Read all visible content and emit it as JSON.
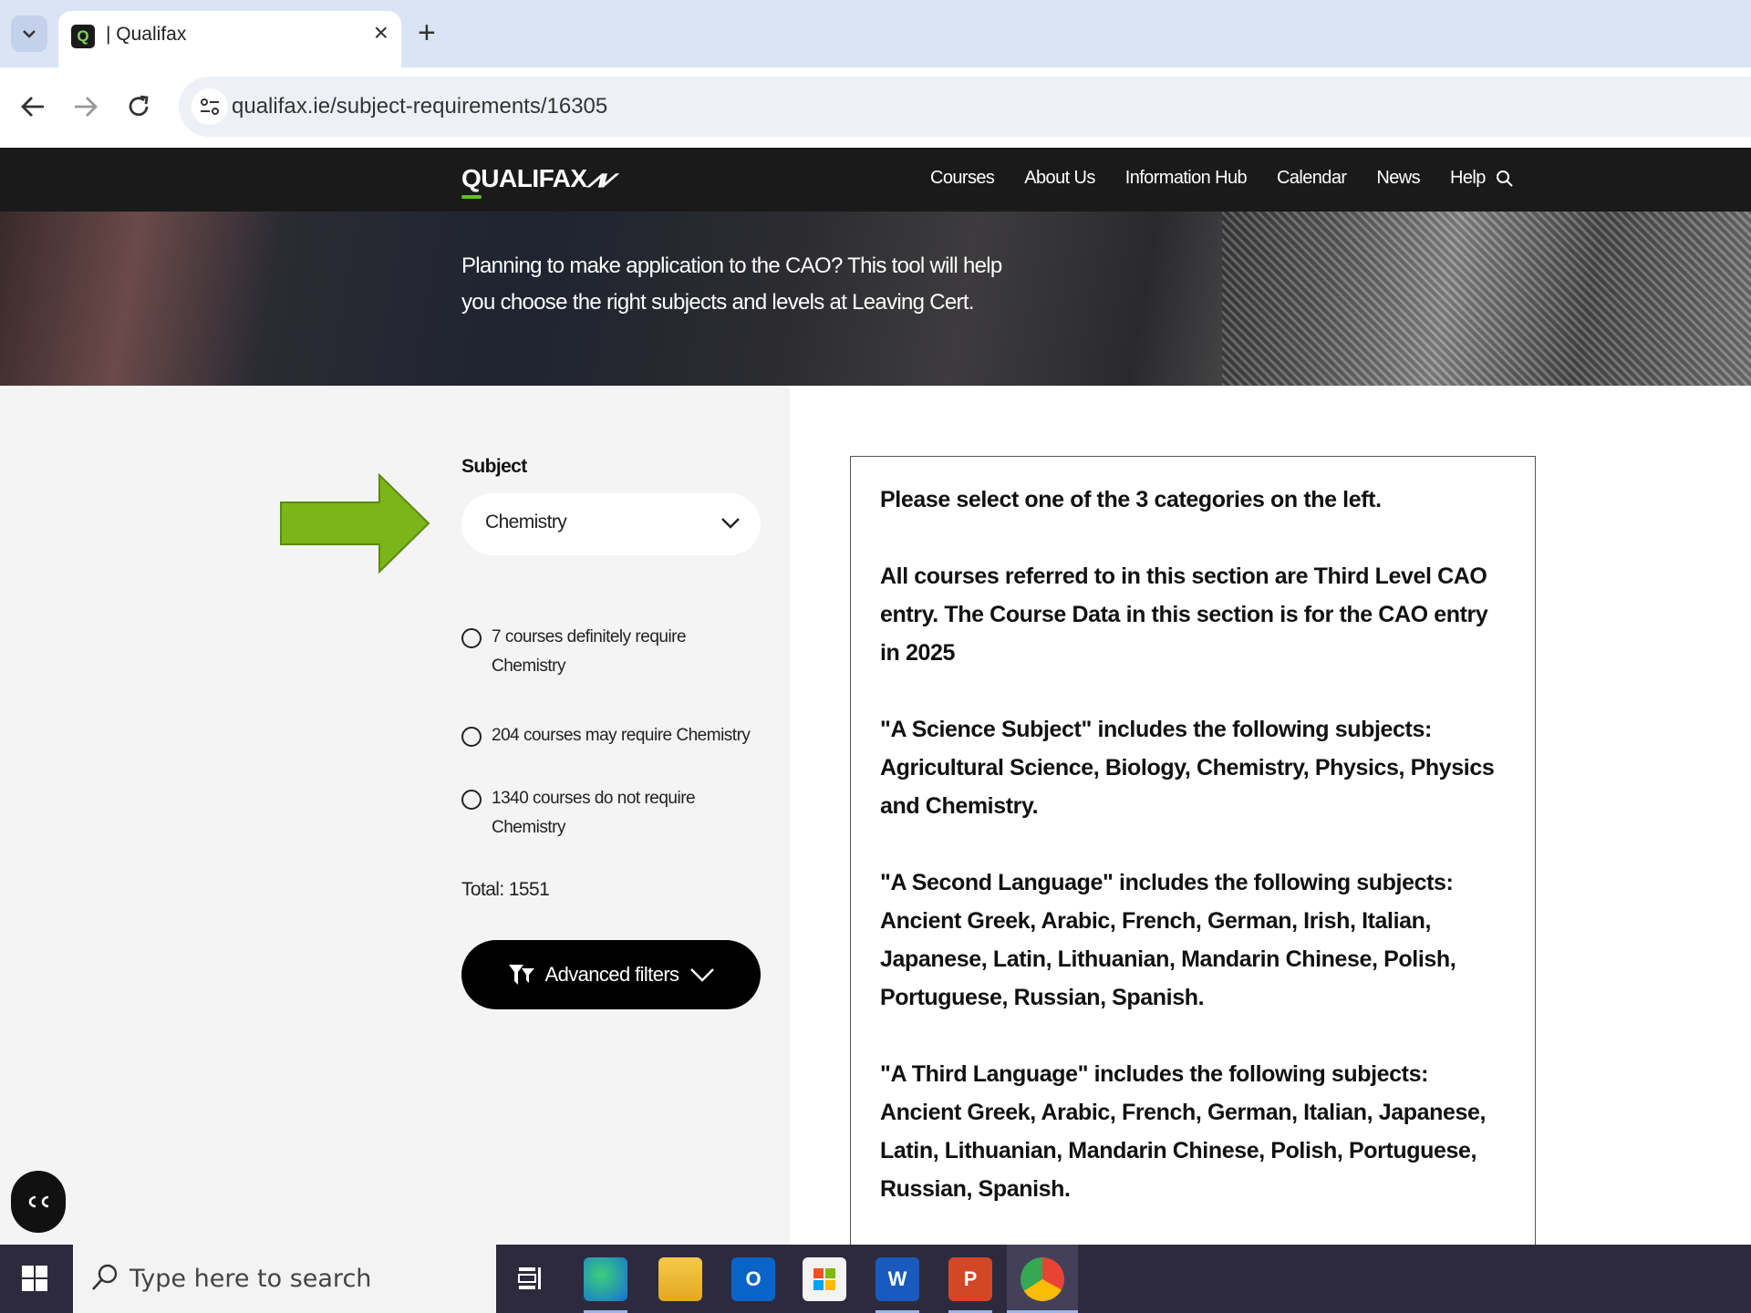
{
  "browser": {
    "tab_title": "| Qualifax",
    "url": "qualifax.ie/subject-requirements/16305"
  },
  "site": {
    "logo": "QUALIFAX",
    "nav": [
      "Courses",
      "About Us",
      "Information Hub",
      "Calendar",
      "News",
      "Help"
    ]
  },
  "hero": {
    "text": "Planning to make application to the CAO? This tool will help you choose the right subjects and levels at Leaving Cert."
  },
  "filters": {
    "subject_label": "Subject",
    "subject_value": "Chemistry",
    "options": [
      "7 courses definitely require Chemistry",
      "204 courses may require Chemistry",
      "1340 courses do not require Chemistry"
    ],
    "total": "Total: 1551",
    "advanced_label": "Advanced filters"
  },
  "info": {
    "paragraphs": [
      "Please select one of the 3 categories on the left.",
      "All courses referred to in this section are Third Level CAO entry. The Course Data in this section is for the CAO entry in 2025",
      "\"A Science Subject\" includes the following subjects: Agricultural Science, Biology, Chemistry, Physics, Physics and Chemistry.",
      "\"A Second Language\" includes the following subjects: Ancient Greek, Arabic, French, German, Irish, Italian, Japanese, Latin, Lithuanian, Mandarin Chinese, Polish, Portuguese, Russian, Spanish.",
      "\"A Third Language\" includes the following subjects: Ancient Greek, Arabic, French, German, Italian, Japanese, Latin, Lithuanian, Mandarin Chinese, Polish, Portuguese, Russian, Spanish."
    ]
  },
  "taskbar": {
    "search_placeholder": "Type here to search",
    "outlook_letter": "O",
    "word_letter": "W",
    "powerpoint_letter": "P"
  },
  "colors": {
    "accent_green": "#7cb518",
    "header_bg": "#1a1a1a",
    "taskbar_bg": "#2d2a3e"
  }
}
